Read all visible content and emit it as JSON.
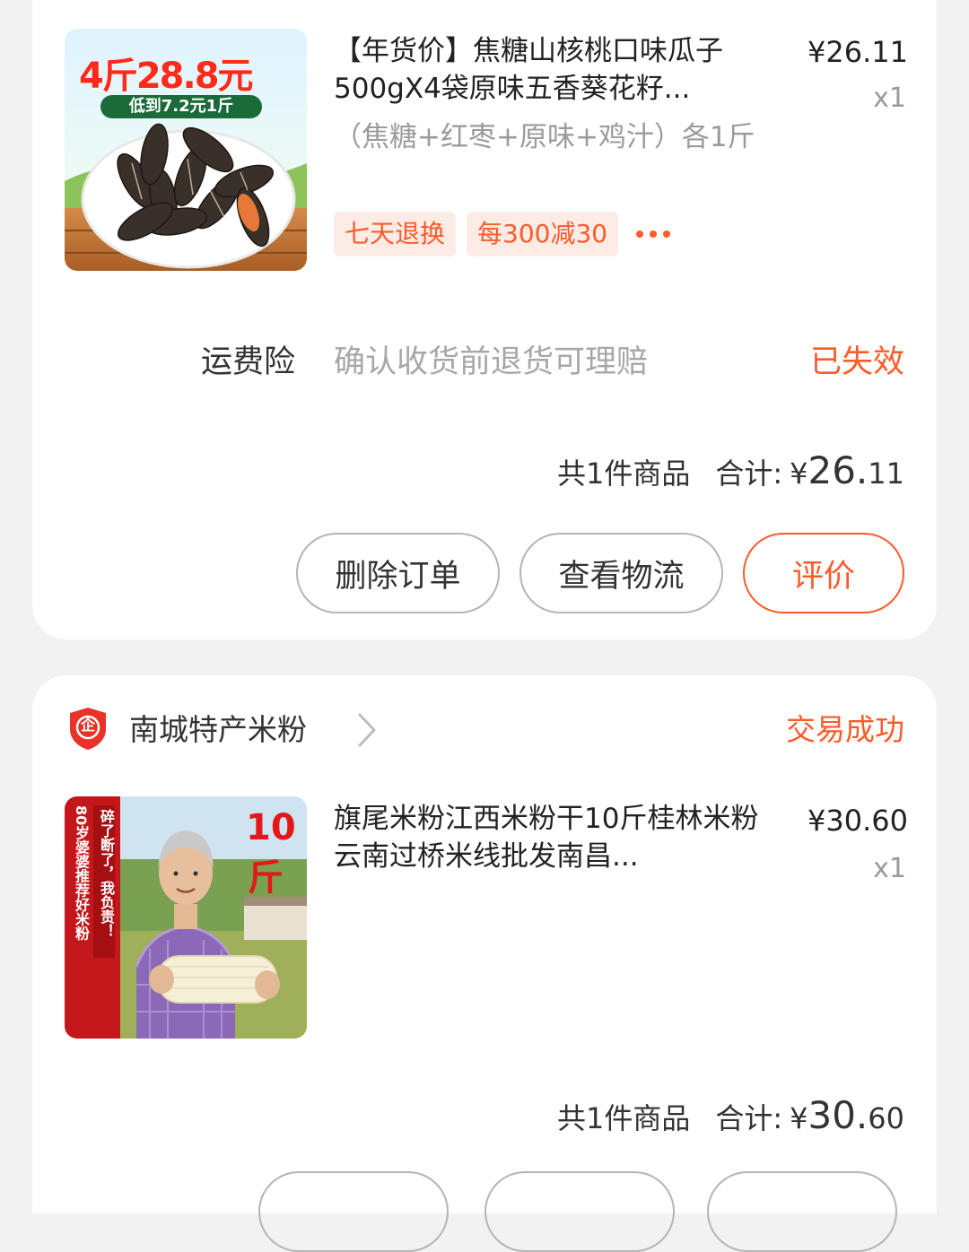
{
  "orders": [
    {
      "item": {
        "thumb_headline": "4斤28.8元",
        "thumb_subline": "低到7.2元1斤",
        "title": "【年货价】焦糖山核桃口味瓜子500gX4袋原味五香葵花籽...",
        "variant": "（焦糖+红枣+原味+鸡汁）各1斤",
        "price": "¥26.11",
        "qty": "x1",
        "tags": [
          "七天退换",
          "每300减30"
        ]
      },
      "insurance": {
        "label": "运费险",
        "desc": "确认收货前退货可理赔",
        "status": "已失效"
      },
      "summary": {
        "count": "共1件商品",
        "total_label": "合计:",
        "currency": "¥",
        "total_int": "26.",
        "total_dec": "11"
      },
      "actions": [
        "删除订单",
        "查看物流",
        "评价"
      ]
    },
    {
      "shop": {
        "icon_char": "企",
        "name": "南城特产米粉",
        "status": "交易成功"
      },
      "item": {
        "thumb_big_1": "10",
        "thumb_big_2": "斤",
        "thumb_vertical_1": "80岁婆婆推荐好米粉",
        "thumb_vertical_2": "碎了断了，我负责！",
        "title": "旗尾米粉江西米粉干10斤桂林米粉云南过桥米线批发南昌...",
        "price": "¥30.60",
        "qty": "x1"
      },
      "summary": {
        "count": "共1件商品",
        "total_label": "合计:",
        "currency": "¥",
        "total_int": "30.",
        "total_dec": "60"
      }
    }
  ],
  "colors": {
    "accent": "#ff5a2a",
    "background": "#f2f2f2",
    "card": "#ffffff",
    "muted_text": "#9b9b9b"
  }
}
